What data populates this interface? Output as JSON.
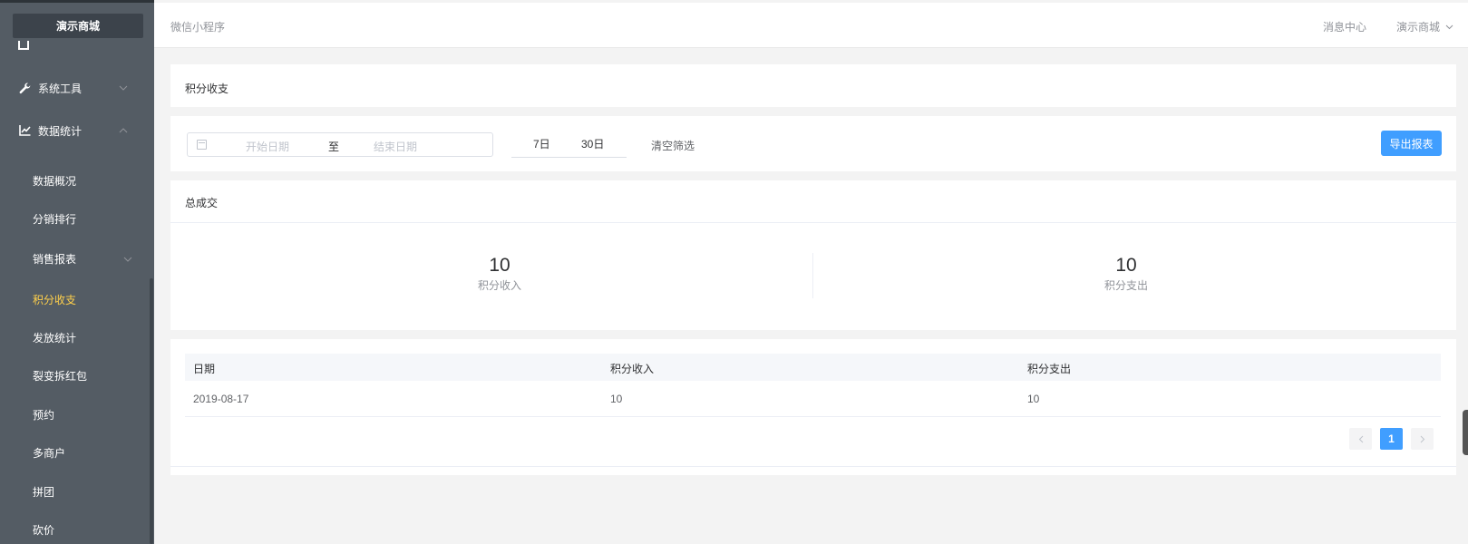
{
  "sidebar": {
    "brand": "演示商城",
    "menus": [
      {
        "label": "系统工具",
        "icon": "wrench-icon",
        "expanded": false
      },
      {
        "label": "数据统计",
        "icon": "line-chart-icon",
        "expanded": true
      }
    ],
    "sub_items": [
      "数据概况",
      "分销排行",
      "销售报表",
      "积分收支",
      "发放统计",
      "裂变拆红包",
      "预约",
      "多商户",
      "拼团",
      "砍价"
    ],
    "active_item": "积分收支"
  },
  "topbar": {
    "breadcrumb": "微信小程序",
    "message_center": "消息中心",
    "user": "演示商城"
  },
  "page": {
    "title": "积分收支"
  },
  "filter": {
    "start_placeholder": "开始日期",
    "separator": "至",
    "end_placeholder": "结束日期",
    "quick_7": "7日",
    "quick_30": "30日",
    "clear": "清空筛选",
    "export": "导出报表"
  },
  "summary": {
    "title": "总成交",
    "income_value": "10",
    "income_label": "积分收入",
    "expense_value": "10",
    "expense_label": "积分支出"
  },
  "table": {
    "columns": [
      "日期",
      "积分收入",
      "积分支出"
    ],
    "rows": [
      [
        "2019-08-17",
        "10",
        "10"
      ]
    ]
  },
  "pagination": {
    "current": "1"
  },
  "colors": {
    "sidebar_bg": "#545c64",
    "active_text": "#ffd04b",
    "primary": "#409eff"
  }
}
